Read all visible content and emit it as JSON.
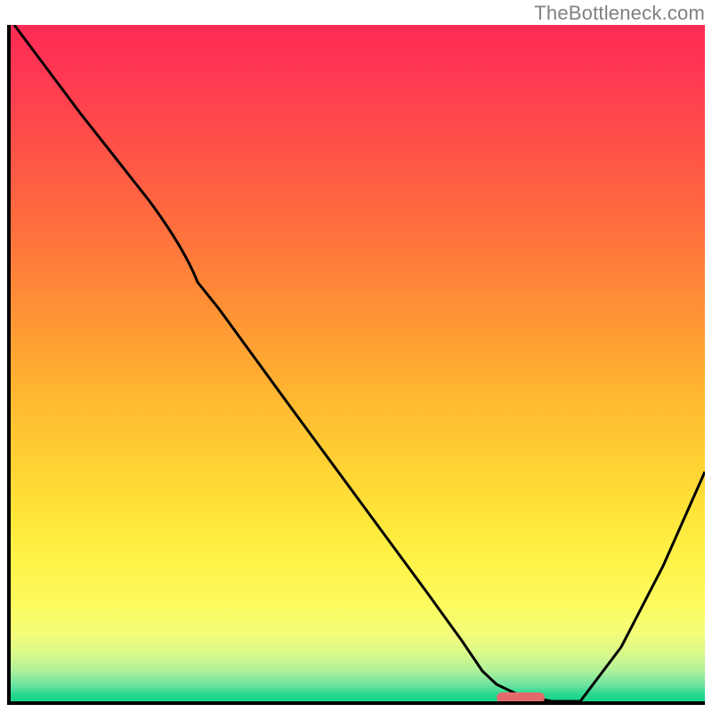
{
  "watermark": "TheBottleneck.com",
  "chart_data": {
    "type": "line",
    "title": "",
    "xlabel": "",
    "ylabel": "",
    "xlim": [
      0,
      100
    ],
    "ylim": [
      0,
      100
    ],
    "grid": false,
    "legend": null,
    "gradient_stops": [
      {
        "pos": 0,
        "color": "#ff2a55"
      },
      {
        "pos": 8,
        "color": "#ff3a52"
      },
      {
        "pos": 18,
        "color": "#ff5148"
      },
      {
        "pos": 28,
        "color": "#ff6a3f"
      },
      {
        "pos": 38,
        "color": "#ff8538"
      },
      {
        "pos": 47,
        "color": "#ffa033"
      },
      {
        "pos": 56,
        "color": "#ffba31"
      },
      {
        "pos": 65,
        "color": "#ffd233"
      },
      {
        "pos": 73,
        "color": "#ffe63a"
      },
      {
        "pos": 80,
        "color": "#fff44a"
      },
      {
        "pos": 86,
        "color": "#fcfb60"
      },
      {
        "pos": 90,
        "color": "#f4fd7a"
      },
      {
        "pos": 93,
        "color": "#d8f98a"
      },
      {
        "pos": 95.5,
        "color": "#aef09a"
      },
      {
        "pos": 97.5,
        "color": "#6fe3a0"
      },
      {
        "pos": 99,
        "color": "#28d890"
      },
      {
        "pos": 100,
        "color": "#18d488"
      }
    ],
    "series": [
      {
        "name": "curve",
        "x": [
          0.5,
          10,
          20,
          25,
          30,
          40,
          50,
          60,
          65,
          68,
          70,
          73,
          78,
          82,
          88,
          94,
          100
        ],
        "y": [
          100,
          87,
          74,
          67,
          58,
          44,
          30,
          16,
          9,
          4.5,
          2.5,
          1,
          0,
          0,
          8,
          20,
          34
        ]
      }
    ],
    "optimal_marker": {
      "x_start": 70,
      "x_end": 77,
      "y": 0,
      "color": "#e26a6a"
    }
  }
}
